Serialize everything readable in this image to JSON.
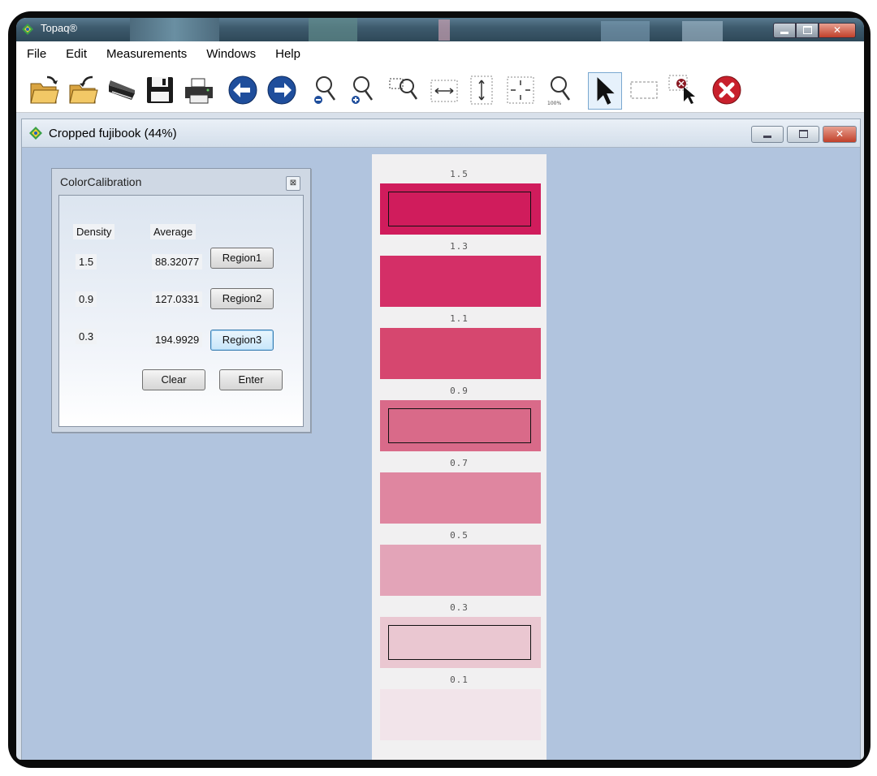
{
  "window": {
    "title": "Topaq®"
  },
  "menu": {
    "items": [
      "File",
      "Edit",
      "Measurements",
      "Windows",
      "Help"
    ]
  },
  "toolbar": {
    "icons": [
      "open-folder-icon",
      "open-recent-icon",
      "scanner-icon",
      "save-icon",
      "print-icon",
      "back-arrow-icon",
      "forward-arrow-icon",
      "zoom-out-icon",
      "zoom-in-icon",
      "zoom-region-icon",
      "fit-width-icon",
      "fit-height-icon",
      "fit-all-icon",
      "zoom-100-icon",
      "pointer-icon",
      "select-region-icon",
      "delete-selection-icon",
      "stop-icon"
    ],
    "zoom_100_label": "100%"
  },
  "child_window": {
    "title": "Cropped fujibook (44%)"
  },
  "color_calibration": {
    "title": "ColorCalibration",
    "close_glyph": "⊠",
    "density_header": "Density",
    "average_header": "Average",
    "rows": [
      {
        "density": "1.5",
        "average": "88.32077",
        "button": "Region1"
      },
      {
        "density": "0.9",
        "average": "127.0331",
        "button": "Region2"
      },
      {
        "density": "0.3",
        "average": "194.9929",
        "button": "Region3"
      }
    ],
    "clear_label": "Clear",
    "enter_label": "Enter"
  },
  "strip": {
    "swatches": [
      {
        "label": "1.5",
        "color": "#d01c5c",
        "selected": true
      },
      {
        "label": "1.3",
        "color": "#d42f67",
        "selected": false
      },
      {
        "label": "1.1",
        "color": "#d6476f",
        "selected": false
      },
      {
        "label": "0.9",
        "color": "#d96a89",
        "selected": true
      },
      {
        "label": "0.7",
        "color": "#df86a0",
        "selected": false
      },
      {
        "label": "0.5",
        "color": "#e3a4b8",
        "selected": false
      },
      {
        "label": "0.3",
        "color": "#eac7d1",
        "selected": true
      },
      {
        "label": "0.1",
        "color": "#f2e4ea",
        "selected": false
      }
    ]
  },
  "colors": {
    "mdi_background": "#b1c4de",
    "title_bar": "#3e5b6e",
    "stop_red": "#c8202c",
    "arrow_blue": "#1f4e9c"
  }
}
